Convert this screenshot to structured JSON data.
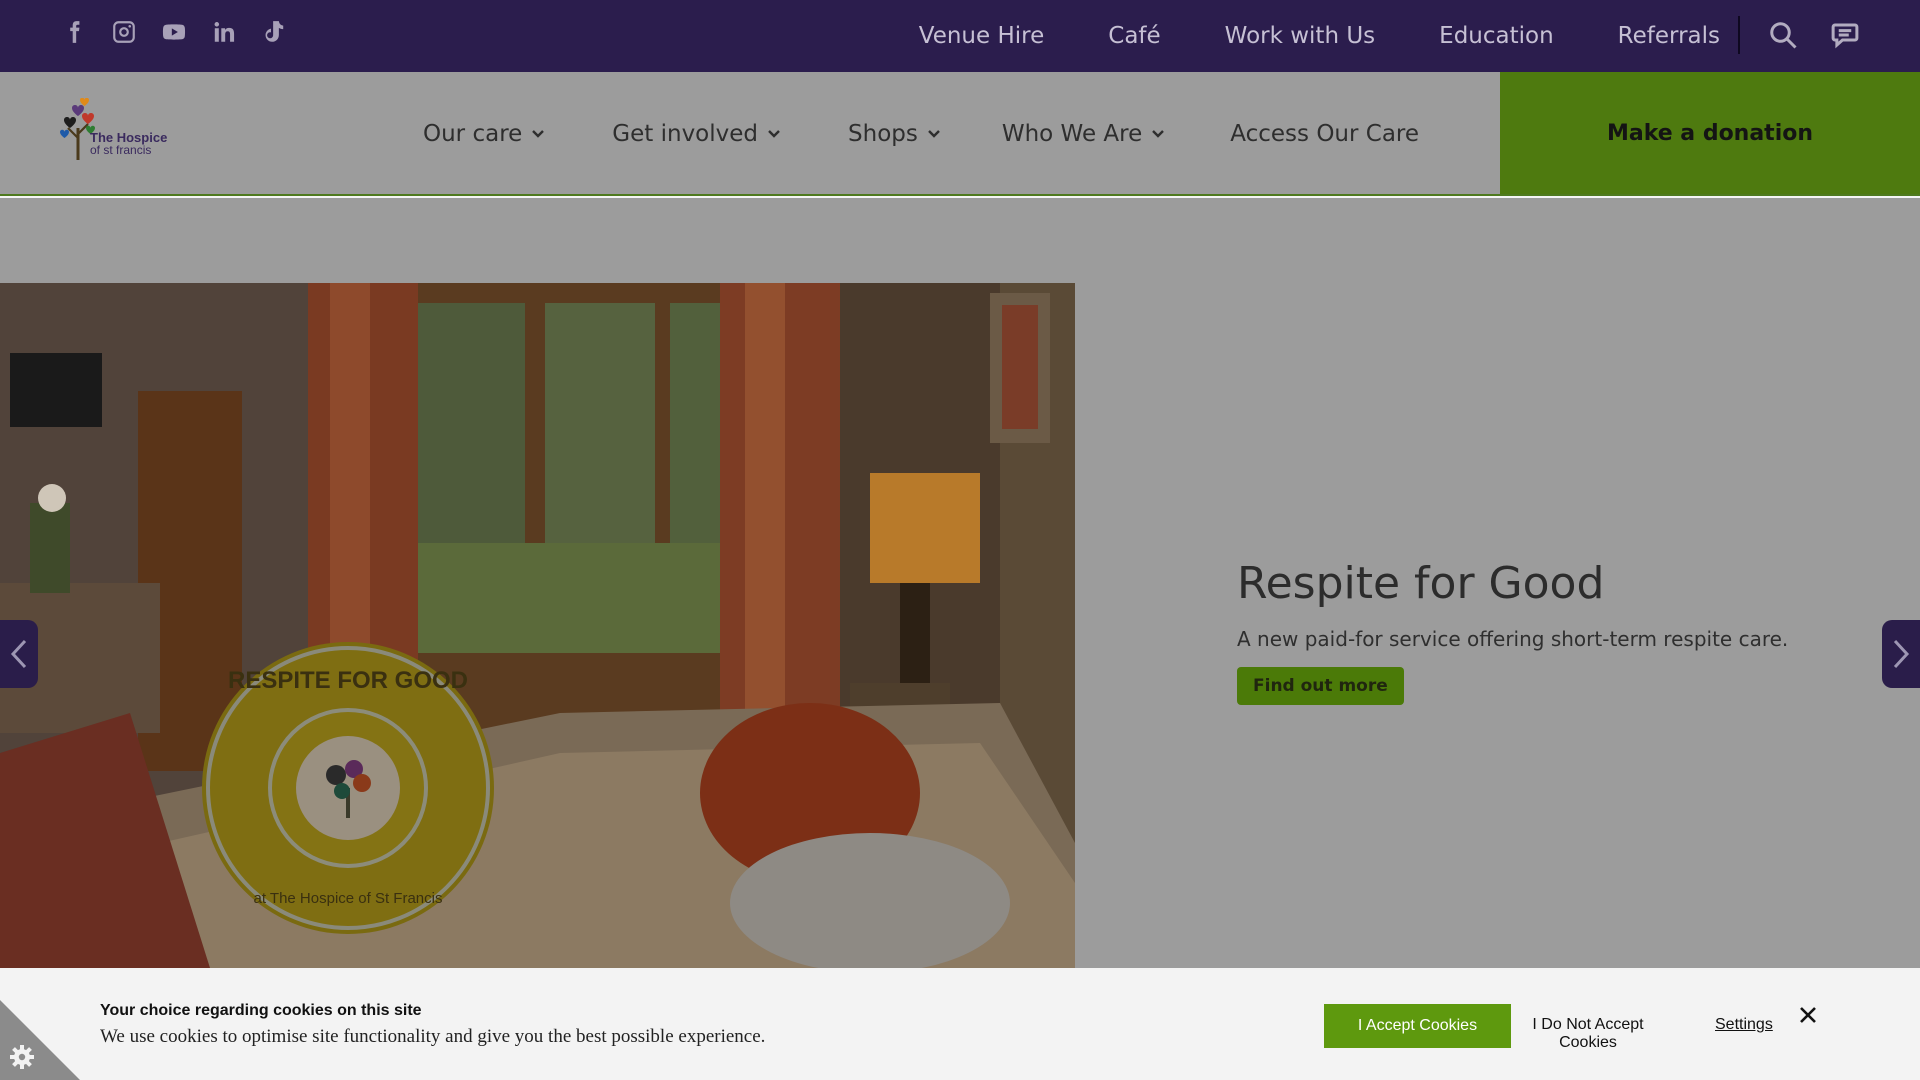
{
  "topbar": {
    "social_icons": [
      "facebook-icon",
      "instagram-icon",
      "youtube-icon",
      "linkedin-icon",
      "tiktok-icon"
    ],
    "links": [
      "Venue Hire",
      "Café",
      "Work with Us",
      "Education",
      "Referrals"
    ],
    "icons": [
      "search-icon",
      "chat-icon"
    ]
  },
  "header": {
    "logo": {
      "line1": "The Hospice",
      "line2": "of st francis"
    },
    "nav": [
      {
        "label": "Our care",
        "dropdown": true
      },
      {
        "label": "Get involved",
        "dropdown": true
      },
      {
        "label": "Shops",
        "dropdown": true
      },
      {
        "label": "Who We Are",
        "dropdown": true
      },
      {
        "label": "Access Our Care",
        "dropdown": false
      }
    ],
    "donate_label": "Make a donation"
  },
  "hero": {
    "title": "Respite for Good",
    "subtitle": "A new paid-for service offering short-term respite care.",
    "button_label": "Find out more",
    "badge": {
      "top": "RESPITE FOR GOOD",
      "bottom": "at The Hospice of St Francis"
    }
  },
  "cookie_banner": {
    "title": "Your choice regarding cookies on this site",
    "description": "We use cookies to optimise site functionality and give you the best possible experience.",
    "accept_label": "I Accept Cookies",
    "decline_label": "I Do Not Accept Cookies",
    "settings_label": "Settings"
  },
  "colors": {
    "topbar": "#2b1d4d",
    "accent_green": "#4e7a0f",
    "overlay_grey": "#9c9c9c"
  }
}
